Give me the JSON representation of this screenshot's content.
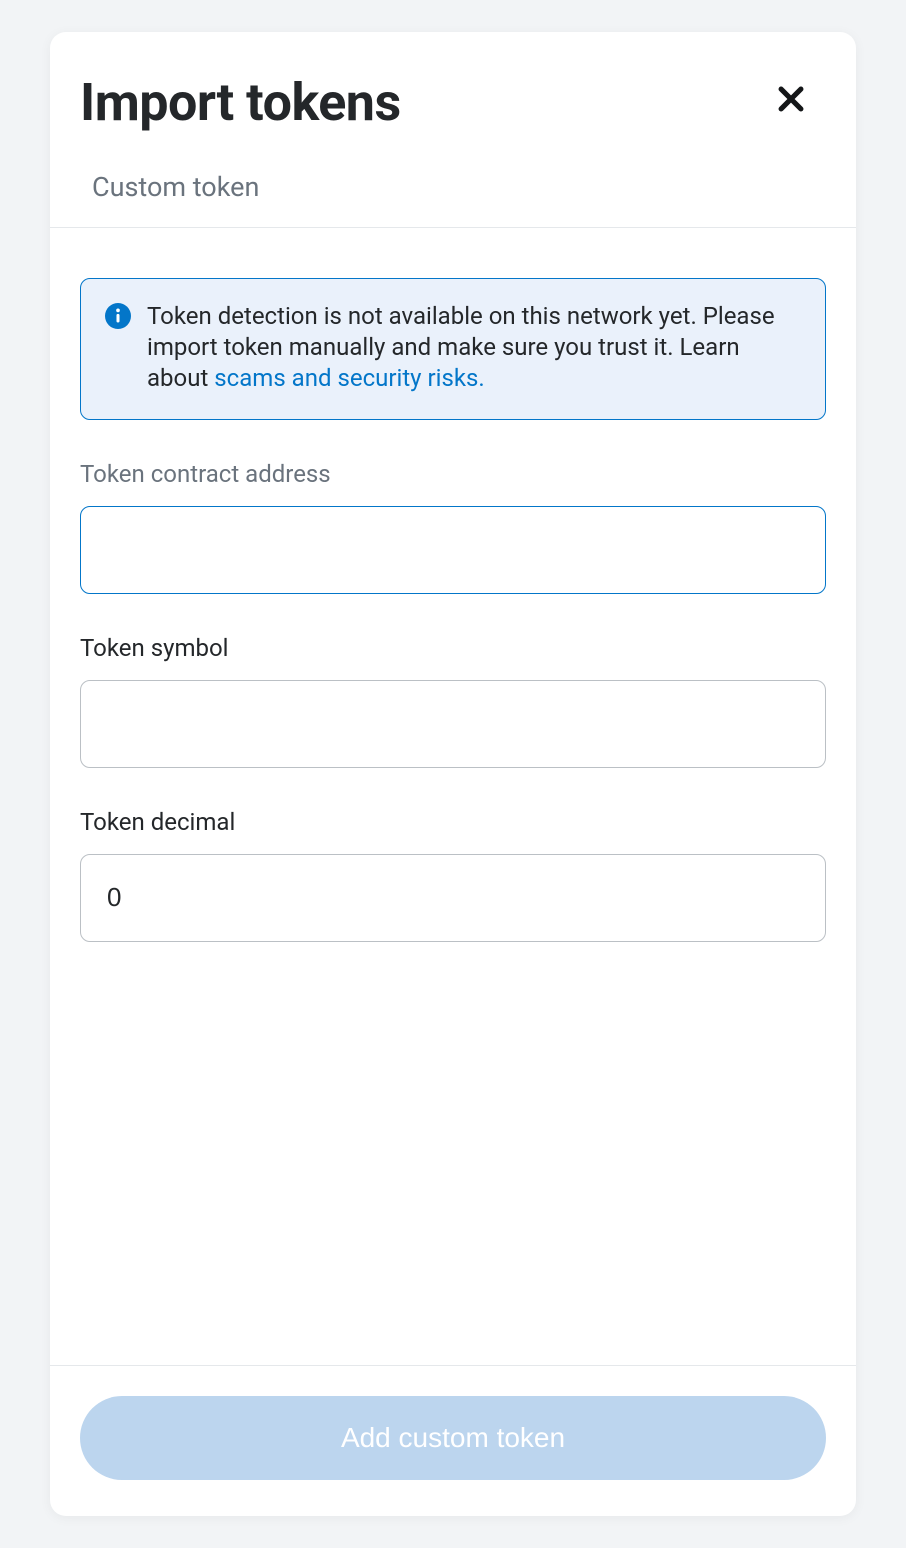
{
  "header": {
    "title": "Import tokens"
  },
  "tab": {
    "label": "Custom token"
  },
  "info": {
    "text_a": "Token detection is not available on this network yet. Please import token manually and make sure you trust it. Learn about ",
    "link": "scams and security risks."
  },
  "fields": {
    "address": {
      "label": "Token contract address",
      "value": ""
    },
    "symbol": {
      "label": "Token symbol",
      "value": ""
    },
    "decimal": {
      "label": "Token decimal",
      "value": "0"
    }
  },
  "footer": {
    "submit_label": "Add custom token"
  }
}
